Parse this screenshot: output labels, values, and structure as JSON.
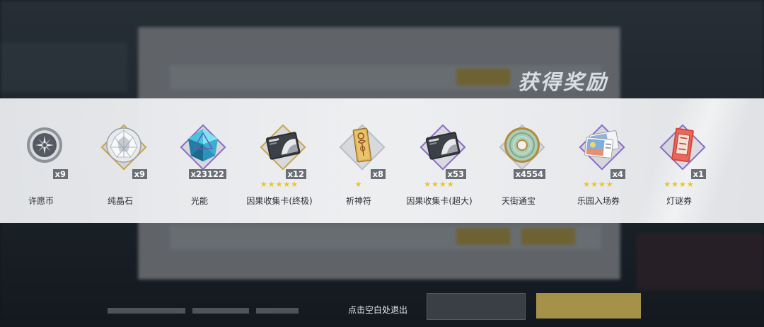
{
  "title": "获得奖励",
  "hint": "点击空白处退出",
  "colors": {
    "gold": "#c9a54a",
    "purple": "#8a6cc9",
    "star": "#f1c21b"
  },
  "rewards": [
    {
      "name": "许愿币",
      "count": "x9",
      "stars": "",
      "frame": "none",
      "icon": "wish-coin-icon"
    },
    {
      "name": "纯晶石",
      "count": "x9",
      "stars": "",
      "frame": "gold",
      "icon": "crystal-icon"
    },
    {
      "name": "光能",
      "count": "x23122",
      "stars": "",
      "frame": "purple",
      "icon": "light-energy-icon"
    },
    {
      "name": "因果收集卡(终极)",
      "count": "x12",
      "stars": "★★★★★",
      "frame": "gold",
      "icon": "causal-card-icon"
    },
    {
      "name": "祈神符",
      "count": "x8",
      "stars": "★",
      "frame": "none",
      "icon": "talisman-icon"
    },
    {
      "name": "因果收集卡(超大)",
      "count": "x53",
      "stars": "★★★★",
      "frame": "purple",
      "icon": "causal-card-icon"
    },
    {
      "name": "天街通宝",
      "count": "x4554",
      "stars": "",
      "frame": "none",
      "icon": "jade-coin-icon"
    },
    {
      "name": "乐园入场券",
      "count": "x4",
      "stars": "★★★★",
      "frame": "purple",
      "icon": "park-ticket-icon"
    },
    {
      "name": "灯谜券",
      "count": "x1",
      "stars": "★★★★",
      "frame": "purple",
      "icon": "riddle-ticket-icon"
    }
  ]
}
